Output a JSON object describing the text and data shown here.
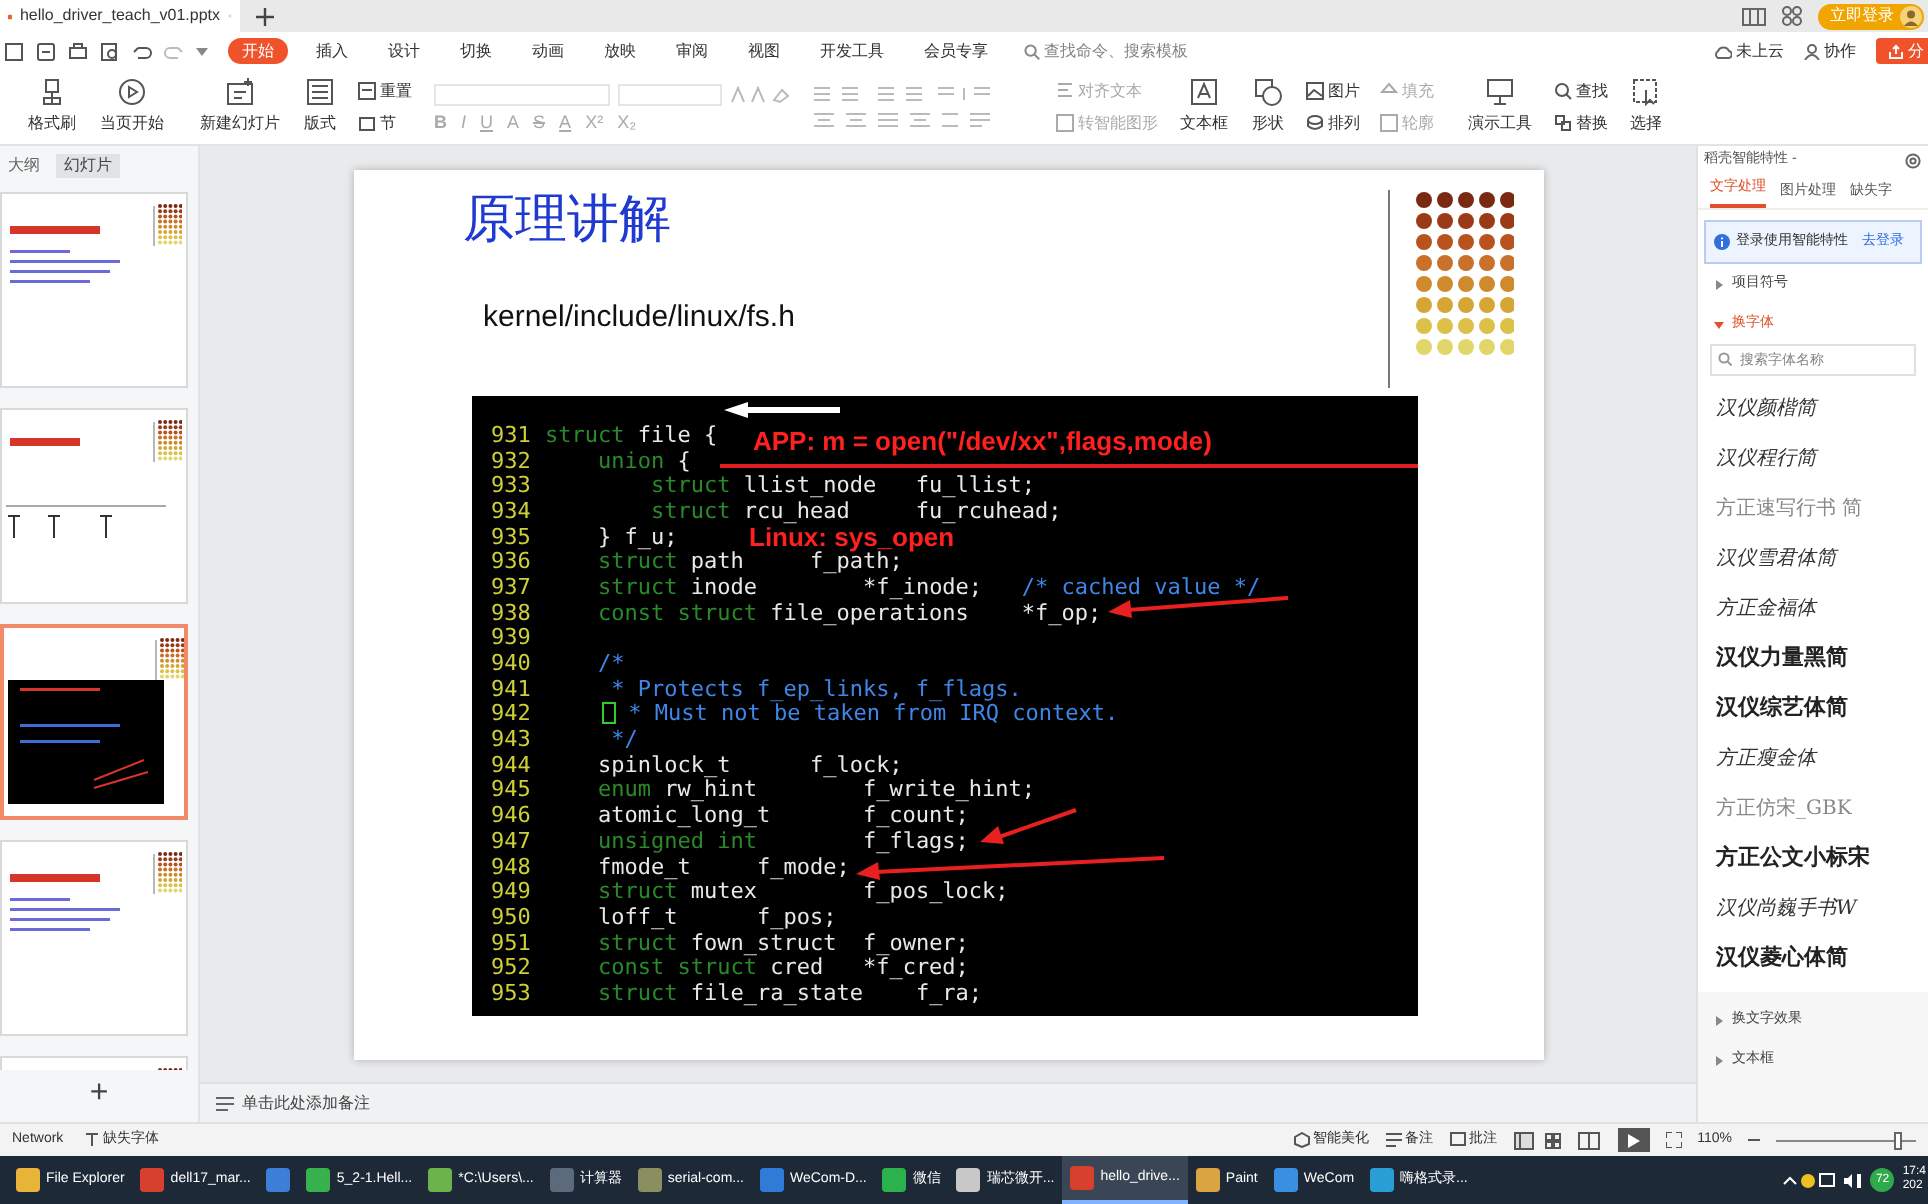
{
  "window": {
    "tab_title": "hello_driver_teach_v01.pptx",
    "login_button": "立即登录"
  },
  "menu": {
    "tabs": [
      {
        "label": "开始",
        "selected": true
      },
      {
        "label": "插入",
        "selected": false
      },
      {
        "label": "设计",
        "selected": false
      },
      {
        "label": "切换",
        "selected": false
      },
      {
        "label": "动画",
        "selected": false
      },
      {
        "label": "放映",
        "selected": false
      },
      {
        "label": "审阅",
        "selected": false
      },
      {
        "label": "视图",
        "selected": false
      },
      {
        "label": "开发工具",
        "selected": false
      },
      {
        "label": "会员专享",
        "selected": false
      }
    ],
    "search": {
      "placeholder": "查找命令、搜索模板"
    },
    "cloud": "未上云",
    "collaborate": "协作",
    "share": "分"
  },
  "ribbon": [
    {
      "kind": "large",
      "label": "格式刷"
    },
    {
      "kind": "large",
      "label": "当页开始"
    },
    {
      "kind": "large",
      "label": "新建幻灯片"
    },
    {
      "kind": "large",
      "label": "版式"
    },
    {
      "kind": "stack",
      "items": [
        {
          "label": "重置",
          "disabled": false
        },
        {
          "label": "节",
          "disabled": false
        }
      ]
    },
    {
      "kind": "format",
      "buttons": [
        "B",
        "I",
        "U",
        "A",
        "S",
        "A",
        "X²",
        "X₂"
      ]
    },
    {
      "kind": "stack",
      "items": [
        {
          "label": "对齐文本",
          "disabled": true
        },
        {
          "label": "转智能图形",
          "disabled": true
        }
      ]
    },
    {
      "kind": "large",
      "label": "文本框"
    },
    {
      "kind": "large",
      "label": "形状"
    },
    {
      "kind": "stack",
      "items": [
        {
          "label": "图片",
          "disabled": false
        },
        {
          "label": "排列",
          "disabled": false
        }
      ]
    },
    {
      "kind": "stack",
      "items": [
        {
          "label": "填充",
          "disabled": true
        },
        {
          "label": "轮廓",
          "disabled": true
        }
      ]
    },
    {
      "kind": "large",
      "label": "演示工具"
    },
    {
      "kind": "stack",
      "items": [
        {
          "label": "查找",
          "disabled": false
        },
        {
          "label": "替换",
          "disabled": false
        }
      ]
    },
    {
      "kind": "large",
      "label": "选择"
    }
  ],
  "left_panel": {
    "tabs": [
      {
        "label": "大纲",
        "selected": false
      },
      {
        "label": "幻灯片",
        "selected": true
      }
    ],
    "thumbnails": [
      {
        "kind": "text",
        "selected": false
      },
      {
        "kind": "diagram",
        "selected": false
      },
      {
        "kind": "code",
        "selected": true
      },
      {
        "kind": "text",
        "selected": false
      },
      {
        "kind": "blank",
        "selected": false
      }
    ],
    "add_button": "+"
  },
  "slide": {
    "title": "原理讲解",
    "subtitle": "kernel/include/linux/fs.h",
    "code": [
      {
        "number": "931",
        "cursor": false,
        "segments": [
          {
            "kind": "keyword",
            "text": "struct"
          },
          {
            "kind": "plain",
            "text": " file {"
          }
        ]
      },
      {
        "number": "932",
        "cursor": false,
        "segments": [
          {
            "kind": "keyword",
            "text": "    union"
          },
          {
            "kind": "plain",
            "text": " {"
          }
        ]
      },
      {
        "number": "933",
        "cursor": false,
        "segments": [
          {
            "kind": "keyword",
            "text": "        struct"
          },
          {
            "kind": "plain",
            "text": " llist_node   fu_llist;"
          }
        ]
      },
      {
        "number": "934",
        "cursor": false,
        "segments": [
          {
            "kind": "keyword",
            "text": "        struct"
          },
          {
            "kind": "plain",
            "text": " rcu_head     fu_rcuhead;"
          }
        ]
      },
      {
        "number": "935",
        "cursor": false,
        "segments": [
          {
            "kind": "plain",
            "text": "    } f_u;"
          }
        ]
      },
      {
        "number": "936",
        "cursor": false,
        "segments": [
          {
            "kind": "keyword",
            "text": "    struct"
          },
          {
            "kind": "plain",
            "text": " path     f_path;"
          }
        ]
      },
      {
        "number": "937",
        "cursor": false,
        "segments": [
          {
            "kind": "keyword",
            "text": "    struct"
          },
          {
            "kind": "plain",
            "text": " inode        *f_inode;   "
          },
          {
            "kind": "comment",
            "text": "/* cached value */"
          }
        ]
      },
      {
        "number": "938",
        "cursor": false,
        "segments": [
          {
            "kind": "keyword",
            "text": "    const struct"
          },
          {
            "kind": "plain",
            "text": " file_operations    *f_op;"
          }
        ]
      },
      {
        "number": "939",
        "cursor": false
      },
      {
        "number": "940",
        "cursor": false,
        "segments": [
          {
            "kind": "comment",
            "text": "    /*"
          }
        ]
      },
      {
        "number": "941",
        "cursor": false,
        "segments": [
          {
            "kind": "comment",
            "text": "     * Protects f_ep_links, f_flags."
          }
        ]
      },
      {
        "number": "942",
        "cursor": true,
        "segments": [
          {
            "kind": "comment",
            "text": " * Must not be taken from IRQ context."
          }
        ]
      },
      {
        "number": "943",
        "cursor": false,
        "segments": [
          {
            "kind": "comment",
            "text": "     */"
          }
        ]
      },
      {
        "number": "944",
        "cursor": false,
        "segments": [
          {
            "kind": "plain",
            "text": "    spinlock_t      f_lock;"
          }
        ]
      },
      {
        "number": "945",
        "cursor": false,
        "segments": [
          {
            "kind": "keyword",
            "text": "    enum"
          },
          {
            "kind": "plain",
            "text": " rw_hint        f_write_hint;"
          }
        ]
      },
      {
        "number": "946",
        "cursor": false,
        "segments": [
          {
            "kind": "plain",
            "text": "    atomic_long_t       f_count;"
          }
        ]
      },
      {
        "number": "947",
        "cursor": false,
        "segments": [
          {
            "kind": "keyword",
            "text": "    unsigned int"
          },
          {
            "kind": "plain",
            "text": "        f_flags;"
          }
        ]
      },
      {
        "number": "948",
        "cursor": false,
        "segments": [
          {
            "kind": "plain",
            "text": "    fmode_t     f_mode;"
          }
        ]
      },
      {
        "number": "949",
        "cursor": false,
        "segments": [
          {
            "kind": "keyword",
            "text": "    struct"
          },
          {
            "kind": "plain",
            "text": " mutex        f_pos_lock;"
          }
        ]
      },
      {
        "number": "950",
        "cursor": false,
        "segments": [
          {
            "kind": "plain",
            "text": "    loff_t      f_pos;"
          }
        ]
      },
      {
        "number": "951",
        "cursor": false,
        "segments": [
          {
            "kind": "keyword",
            "text": "    struct"
          },
          {
            "kind": "plain",
            "text": " fown_struct  f_owner;"
          }
        ]
      },
      {
        "number": "952",
        "cursor": false,
        "segments": [
          {
            "kind": "keyword",
            "text": "    const struct"
          },
          {
            "kind": "plain",
            "text": " cred   *f_cred;"
          }
        ]
      },
      {
        "number": "953",
        "cursor": false,
        "segments": [
          {
            "kind": "keyword",
            "text": "    struct"
          },
          {
            "kind": "plain",
            "text": " file_ra_state    f_ra;"
          }
        ]
      }
    ],
    "annotations": [
      "APP: m = open(\"/dev/xx\",flags,mode)",
      "Linux:  sys_open"
    ]
  },
  "notes_placeholder": "单击此处添加备注",
  "right_panel": {
    "title": "稻壳智能特性 -",
    "tabs": [
      {
        "label": "文字处理",
        "selected": true
      },
      {
        "label": "图片处理",
        "selected": false
      },
      {
        "label": "缺失字",
        "selected": false
      }
    ],
    "notice": "登录使用智能特性",
    "notice_link": "去登录",
    "sections": [
      {
        "label": "项目符号",
        "expanded": false
      },
      {
        "label": "换字体",
        "expanded": true
      }
    ],
    "font_search": {
      "placeholder": "搜索字体名称"
    },
    "fonts": [
      {
        "name": "汉仪颜楷简",
        "kind": "script"
      },
      {
        "name": "汉仪程行简",
        "kind": "script"
      },
      {
        "name": "方正速写行书 简",
        "kind": "light"
      },
      {
        "name": "汉仪雪君体简",
        "kind": "script"
      },
      {
        "name": "方正金福体",
        "kind": "script"
      },
      {
        "name": "汉仪力量黑简",
        "kind": "bold"
      },
      {
        "name": "汉仪综艺体简",
        "kind": "bold"
      },
      {
        "name": "方正瘦金体",
        "kind": "script"
      },
      {
        "name": "方正仿宋_GBK",
        "kind": "light"
      },
      {
        "name": "方正公文小标宋",
        "kind": "bold"
      },
      {
        "name": "汉仪尚巍手书W",
        "kind": "script"
      },
      {
        "name": "汉仪菱心体简",
        "kind": "bold"
      }
    ],
    "bottom_sections": [
      {
        "label": "换文字效果",
        "expanded": false
      },
      {
        "label": "文本框",
        "expanded": false
      }
    ]
  },
  "status_bar": {
    "network": "Network",
    "missing_fonts": "缺失字体",
    "beautify": "智能美化",
    "notes": "备注",
    "comments": "批注",
    "zoom": "110%",
    "zoom_slider": {
      "level": 0.9
    }
  },
  "taskbar": {
    "items": [
      {
        "label": "File Explorer",
        "color": "#e8b53a",
        "selected": false
      },
      {
        "label": "dell17_mar...",
        "color": "#d6402c",
        "selected": false
      },
      {
        "color": "#3b7fd6",
        "selected": false
      },
      {
        "label": "5_2-1.Hell...",
        "color": "#37b24d",
        "selected": false
      },
      {
        "label": "*C:\\Users\\...",
        "color": "#6bb34a",
        "selected": false
      },
      {
        "label": "计算器",
        "color": "#5b6b7b",
        "selected": false
      },
      {
        "label": "serial-com...",
        "color": "#8a8f60",
        "selected": false
      },
      {
        "label": "WeCom-D...",
        "color": "#2f7bd8",
        "selected": false
      },
      {
        "label": "微信",
        "color": "#2bb24c",
        "selected": false
      },
      {
        "label": "瑞芯微开...",
        "color": "#c8c8c8",
        "selected": false
      },
      {
        "label": "hello_drive...",
        "color": "#d6402c",
        "selected": true
      },
      {
        "label": "Paint",
        "color": "#d9a441",
        "selected": false
      },
      {
        "label": "WeCom",
        "color": "#3b8fe0",
        "selected": false
      },
      {
        "label": "嗨格式录...",
        "color": "#2a9fd6",
        "selected": false
      }
    ],
    "tray_badge": "72",
    "time": "17:4",
    "date": "202"
  }
}
